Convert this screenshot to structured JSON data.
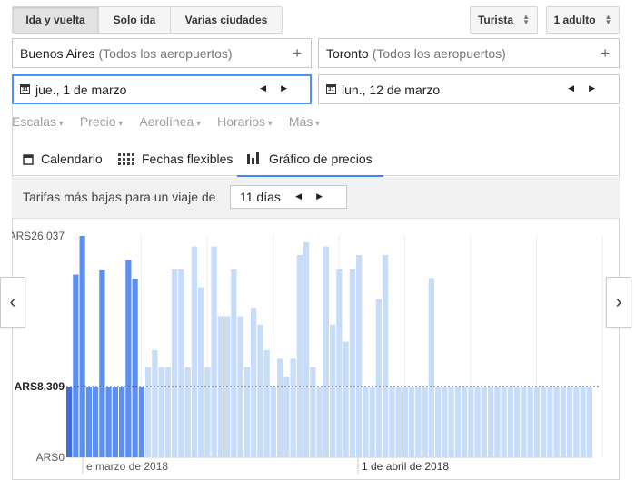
{
  "trip_type": {
    "round": "Ida y vuelta",
    "oneway": "Solo ida",
    "multi": "Varias ciudades"
  },
  "cabin": "Turista",
  "passengers": "1 adulto",
  "origin": {
    "city": "Buenos Aires",
    "detail": "(Todos los aeropuertos)"
  },
  "destination": {
    "city": "Toronto",
    "detail": "(Todos los aeropuertos)"
  },
  "depart_date": "jue., 1 de marzo",
  "return_date": "lun., 12 de marzo",
  "filters": [
    "Escalas",
    "Precio",
    "Aerolínea",
    "Horarios",
    "Más"
  ],
  "tabs": {
    "calendar": "Calendario",
    "flexible": "Fechas flexibles",
    "graph": "Gráfico de precios"
  },
  "fare_row": {
    "label": "Tarifas más bajas para un viaje de",
    "duration": "11 días"
  },
  "colors": {
    "selected": "#3f6fd4",
    "highlight": "#5b8ff0",
    "future": "#c7dcf9",
    "accent": "#4285f4"
  },
  "chart_data": {
    "type": "bar",
    "y_ticks": [
      "ARS26,037",
      "ARS8,309",
      "ARS0"
    ],
    "ylim": [
      0,
      26037
    ],
    "reference_value": 8309,
    "x_labels": [
      "e marzo de 2018",
      "1 de abril de 2018"
    ],
    "selected_index": 0,
    "highlight_count": 12,
    "values": [
      8309,
      21500,
      26037,
      8309,
      8309,
      22000,
      8309,
      8309,
      8309,
      23200,
      21000,
      8309,
      10600,
      12600,
      10600,
      10600,
      22100,
      22100,
      10600,
      24800,
      20000,
      10600,
      24800,
      16600,
      16600,
      22100,
      16600,
      10600,
      17600,
      15600,
      12600,
      8309,
      11600,
      9500,
      11600,
      23800,
      25300,
      10600,
      8309,
      24800,
      15600,
      22100,
      13600,
      22100,
      23800,
      8309,
      8309,
      18600,
      23800,
      8309,
      8309,
      8309,
      8309,
      8309,
      8309,
      21100,
      8309,
      8309,
      8309,
      8309,
      8309,
      8309,
      8309,
      8309,
      8309,
      8309,
      8309,
      8309,
      8309,
      8309,
      8309,
      8309,
      8309,
      8309,
      8309,
      8309,
      8309,
      8309,
      8309,
      8309
    ]
  },
  "chart_values_note": ""
}
